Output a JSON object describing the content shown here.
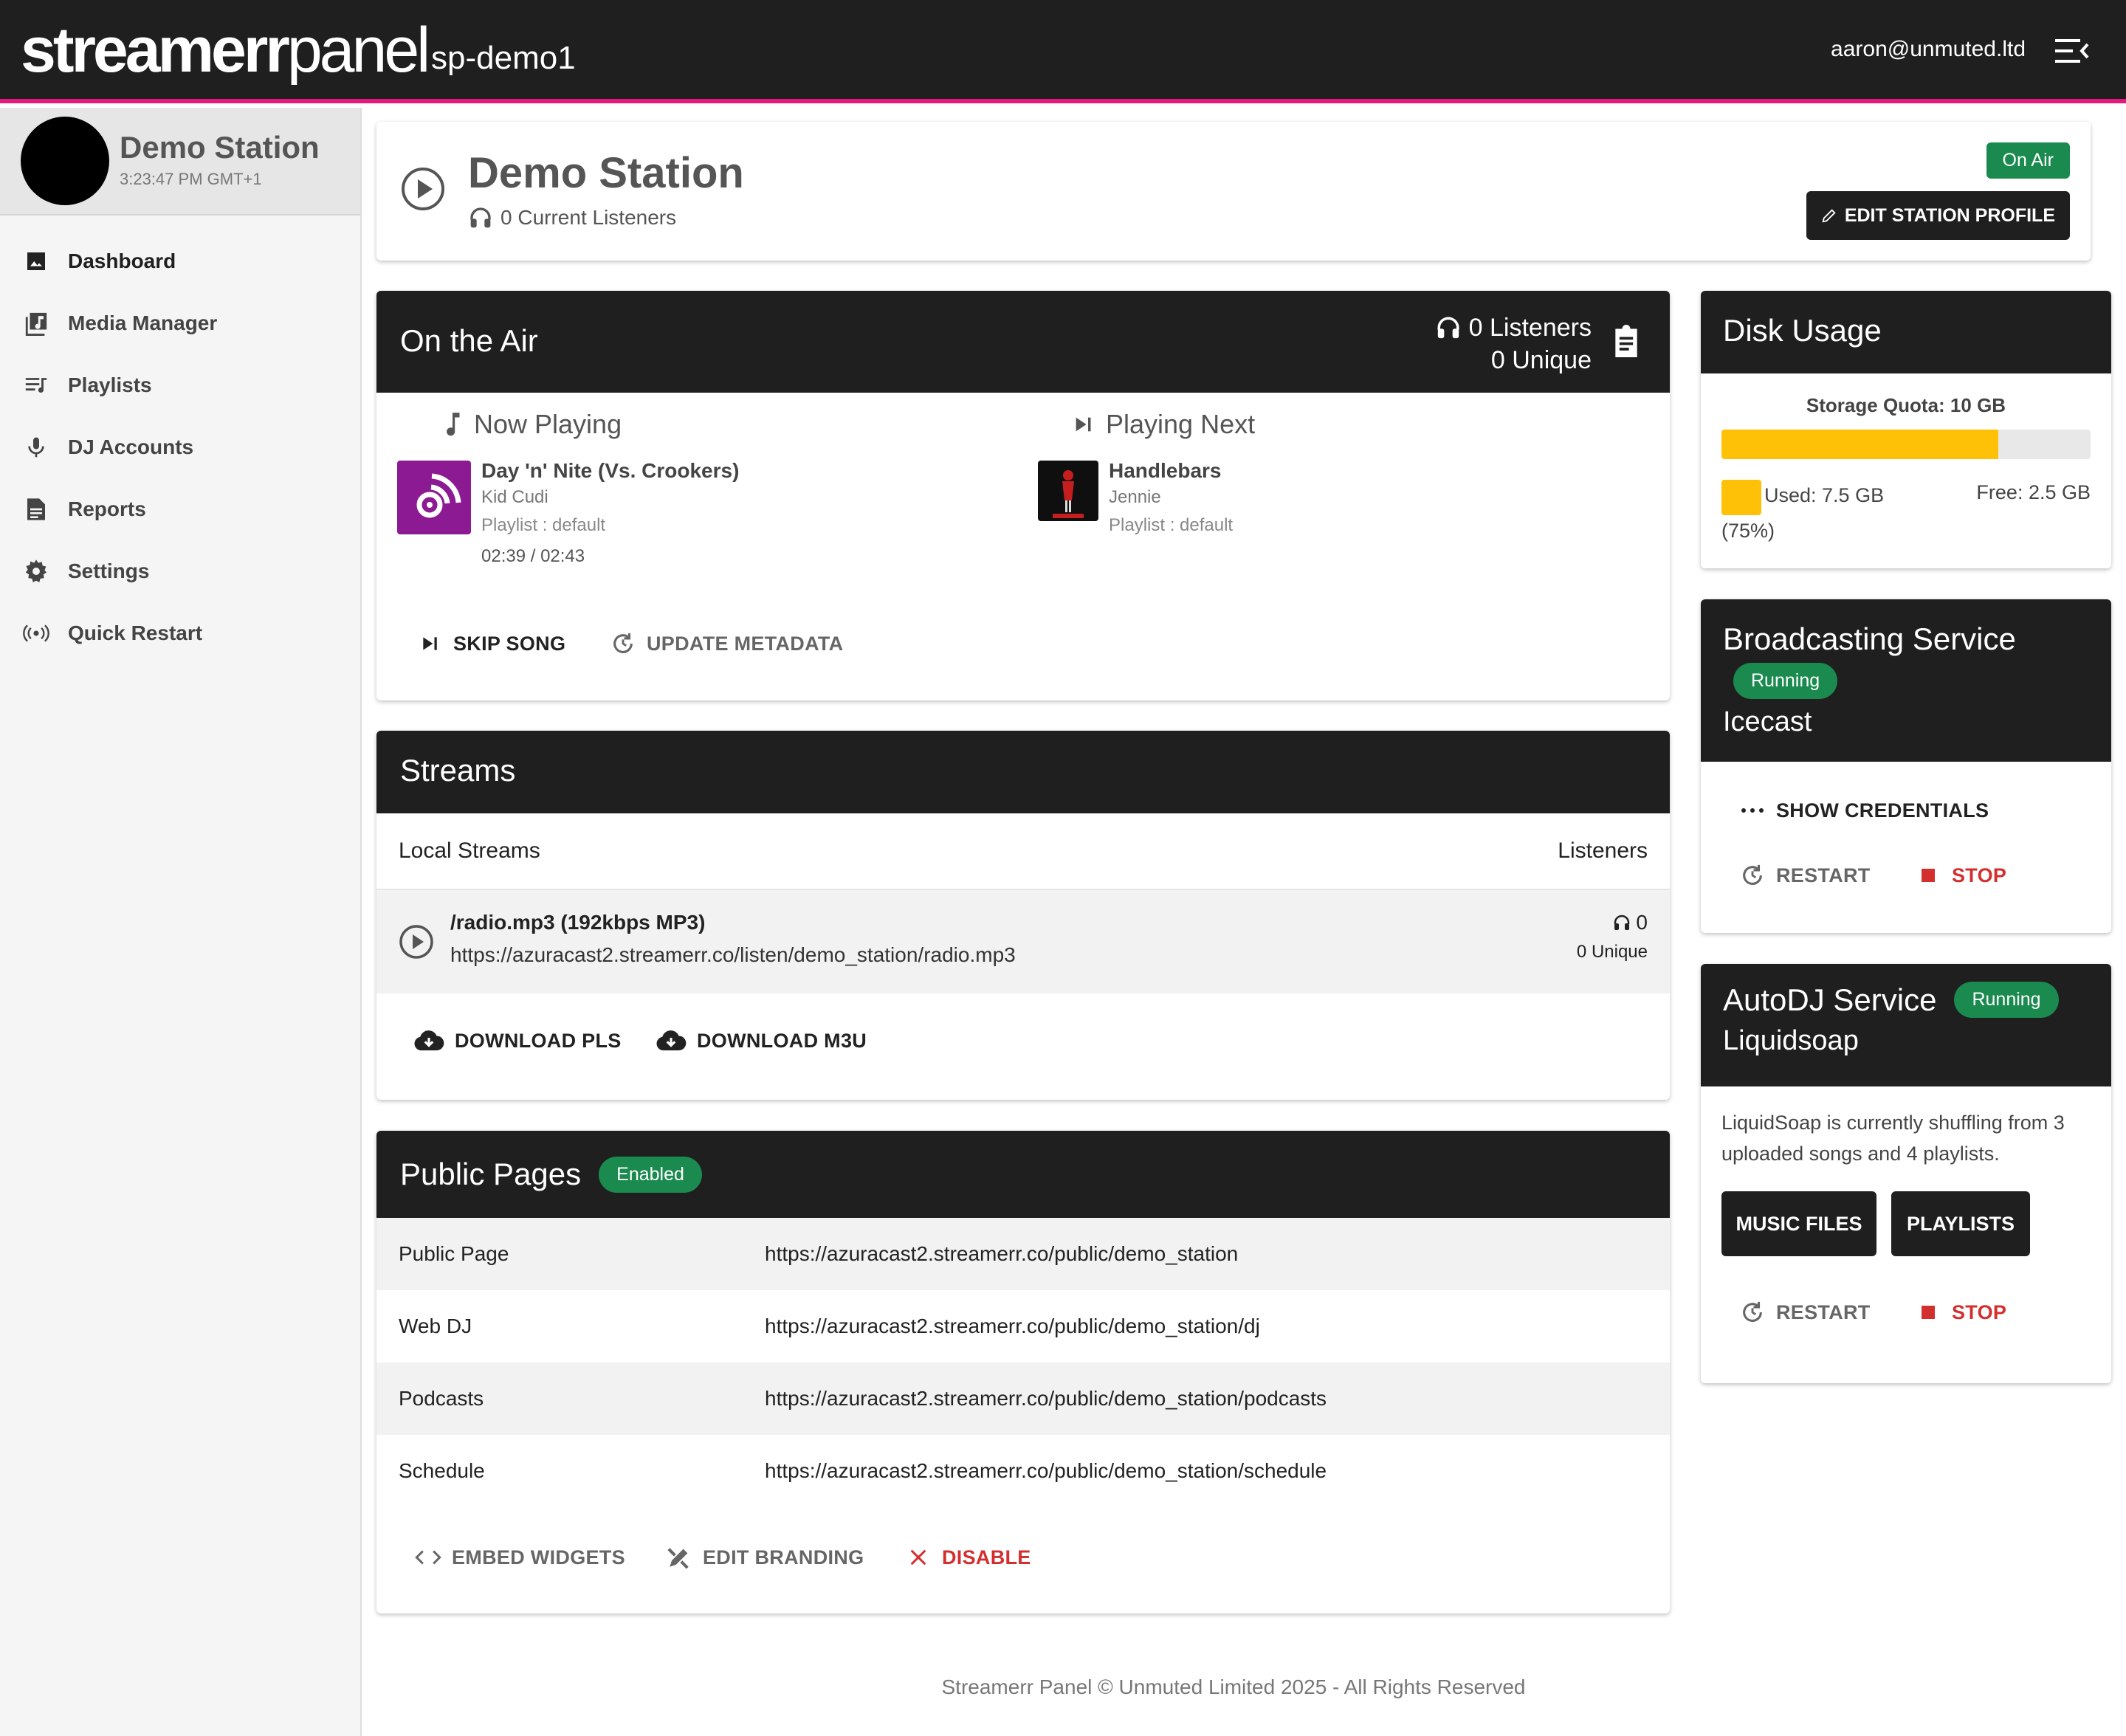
{
  "topbar": {
    "brand_bold": "streamerr",
    "brand_light": "panel",
    "instance": "sp-demo1",
    "user_email": "aaron@unmuted.ltd"
  },
  "sidebar": {
    "station_name": "Demo Station",
    "station_time": "3:23:47 PM GMT+1",
    "items": [
      {
        "label": "Dashboard",
        "icon": "image-icon"
      },
      {
        "label": "Media Manager",
        "icon": "music-library-icon"
      },
      {
        "label": "Playlists",
        "icon": "playlist-icon"
      },
      {
        "label": "DJ Accounts",
        "icon": "microphone-icon"
      },
      {
        "label": "Reports",
        "icon": "report-icon"
      },
      {
        "label": "Settings",
        "icon": "gear-icon"
      },
      {
        "label": "Quick Restart",
        "icon": "broadcast-icon"
      }
    ]
  },
  "header": {
    "title": "Demo Station",
    "listeners": "0 Current Listeners",
    "on_air": "On Air",
    "edit_profile": "EDIT STATION PROFILE"
  },
  "on_air": {
    "title": "On the Air",
    "listeners": "0 Listeners",
    "unique": "0  Unique",
    "now_playing": {
      "label": "Now Playing",
      "title": "Day 'n' Nite (Vs. Crookers)",
      "artist": "Kid Cudi",
      "playlist": "Playlist : default",
      "time": "02:39 / 02:43"
    },
    "playing_next": {
      "label": "Playing Next",
      "title": "Handlebars",
      "artist": "Jennie",
      "playlist": "Playlist : default"
    },
    "skip_song": "SKIP SONG",
    "update_metadata": "UPDATE METADATA"
  },
  "streams": {
    "title": "Streams",
    "local_label": "Local Streams",
    "listeners_label": "Listeners",
    "stream_name": "/radio.mp3 (192kbps MP3)",
    "stream_url": "https://azuracast2.streamerr.co/listen/demo_station/radio.mp3",
    "stream_listeners": "0",
    "stream_unique": "0  Unique",
    "download_pls": "DOWNLOAD PLS",
    "download_m3u": "DOWNLOAD M3U"
  },
  "public_pages": {
    "title": "Public Pages",
    "status": "Enabled",
    "rows": [
      {
        "label": "Public Page",
        "url": "https://azuracast2.streamerr.co/public/demo_station"
      },
      {
        "label": "Web DJ",
        "url": "https://azuracast2.streamerr.co/public/demo_station/dj"
      },
      {
        "label": "Podcasts",
        "url": "https://azuracast2.streamerr.co/public/demo_station/podcasts"
      },
      {
        "label": "Schedule",
        "url": "https://azuracast2.streamerr.co/public/demo_station/schedule"
      }
    ],
    "embed_widgets": "EMBED WIDGETS",
    "edit_branding": "EDIT BRANDING",
    "disable": "DISABLE"
  },
  "disk": {
    "title": "Disk Usage",
    "quota": "Storage Quota: 10 GB",
    "used": "Used: 7.5 GB",
    "used_pct": "(75%)",
    "free": "Free: 2.5 GB",
    "fill_fraction": 0.75
  },
  "broadcasting": {
    "title": "Broadcasting Service",
    "status": "Running",
    "server": "Icecast",
    "show_credentials": "SHOW CREDENTIALS",
    "restart": "RESTART",
    "stop": "STOP"
  },
  "autodj": {
    "title": "AutoDJ Service",
    "status": "Running",
    "engine": "Liquidsoap",
    "description": "LiquidSoap is currently shuffling from 3 uploaded songs and 4 playlists.",
    "music_files": "MUSIC FILES",
    "playlists": "PLAYLISTS",
    "restart": "RESTART",
    "stop": "STOP"
  },
  "footer": "Streamerr Panel © Unmuted Limited 2025 - All Rights Reserved",
  "colors": {
    "topbar": "#1f1f1f",
    "accent": "#e6187b",
    "success": "#1a8a4f",
    "danger": "#d32f2f",
    "warning": "#ffc107"
  }
}
